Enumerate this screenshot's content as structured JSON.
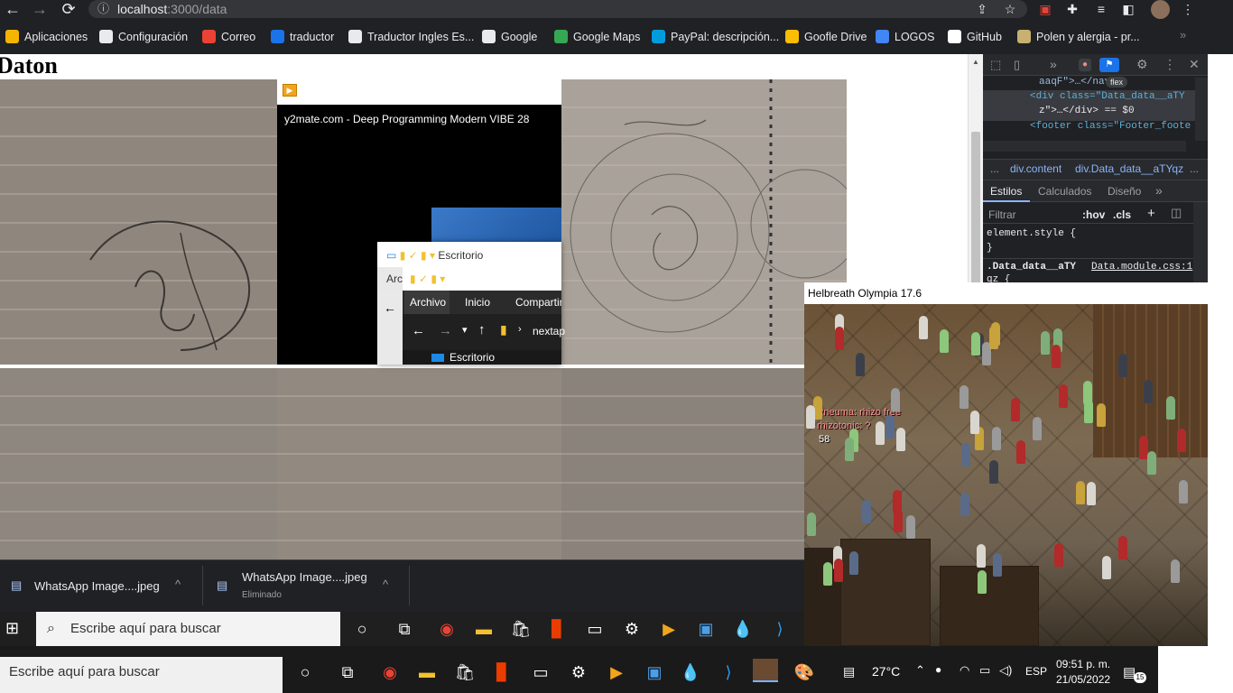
{
  "browser": {
    "url_host": "localhost",
    "url_path": ":3000/data",
    "bookmarks": [
      {
        "label": "Aplicaciones",
        "icon": "apps-grid-icon",
        "color": "#f4b400"
      },
      {
        "label": "Configuración",
        "icon": "gear-icon",
        "color": "#e8eaed"
      },
      {
        "label": "Correo",
        "icon": "gmail-icon",
        "color": "#ea4335"
      },
      {
        "label": "traductor",
        "icon": "translate-icon",
        "color": "#1a73e8"
      },
      {
        "label": "Traductor Ingles Es...",
        "icon": "google-icon",
        "color": "#e8eaed"
      },
      {
        "label": "Google",
        "icon": "google-icon",
        "color": "#e8eaed"
      },
      {
        "label": "Google Maps",
        "icon": "maps-pin-icon",
        "color": "#34a853"
      },
      {
        "label": "PayPal: descripción...",
        "icon": "paypal-icon",
        "color": "#009cde"
      },
      {
        "label": "Goofle Drive",
        "icon": "drive-icon",
        "color": "#fbbc04"
      },
      {
        "label": "LOGOS",
        "icon": "logos-icon",
        "color": "#4285f4"
      },
      {
        "label": "GitHub",
        "icon": "github-icon",
        "color": "#ffffff"
      },
      {
        "label": "Polen y alergia - pr...",
        "icon": "polen-icon",
        "color": "#c8b070"
      }
    ]
  },
  "page": {
    "title": "Daton"
  },
  "video": {
    "title": "y2mate.com - Deep Programming  Modern VIBE  28"
  },
  "explorer": {
    "window_title": "Escritorio",
    "tabs": [
      "Archivo",
      "Inicio",
      "Compartir"
    ],
    "partial_tab": "Arc",
    "address": "nextap",
    "tree_item": "Escritorio"
  },
  "devtools": {
    "flex_badge": "flex",
    "code_lines": [
      "aaqF\">…</nav>",
      "<div class=\"Data_data__aTY",
      "z\">…</div> == $0",
      "<footer class=\"Footer_foote"
    ],
    "breadcrumb": [
      "...",
      "div.content",
      "div.Data_data__aTYqz",
      "..."
    ],
    "tabs": [
      "Estilos",
      "Calculados",
      "Diseño"
    ],
    "filter_placeholder": "Filtrar",
    "hov": ":hov",
    "cls": ".cls",
    "element_style": "element.style {",
    "closing_brace": "}",
    "rule_selector": ".Data_data__aTY",
    "rule_source": "Data.module.css:1",
    "rule_cont": "qz {"
  },
  "game": {
    "window_title": "Helbreath Olympia 17.6",
    "chat_lines": [
      "Pneuma: rhizo free",
      "rhizotonic: ?",
      "58"
    ]
  },
  "downloads": [
    {
      "name": "WhatsApp Image....jpeg",
      "status": ""
    },
    {
      "name": "WhatsApp Image....jpeg",
      "status": "Eliminado"
    }
  ],
  "taskbar": {
    "search_placeholder_1": "Escribe aquí para buscar",
    "search_placeholder_2": "Escribe aquí para buscar",
    "temperature": "27°C",
    "language": "ESP",
    "time": "09:51 p. m.",
    "date": "21/05/2022",
    "notifications": "15"
  }
}
